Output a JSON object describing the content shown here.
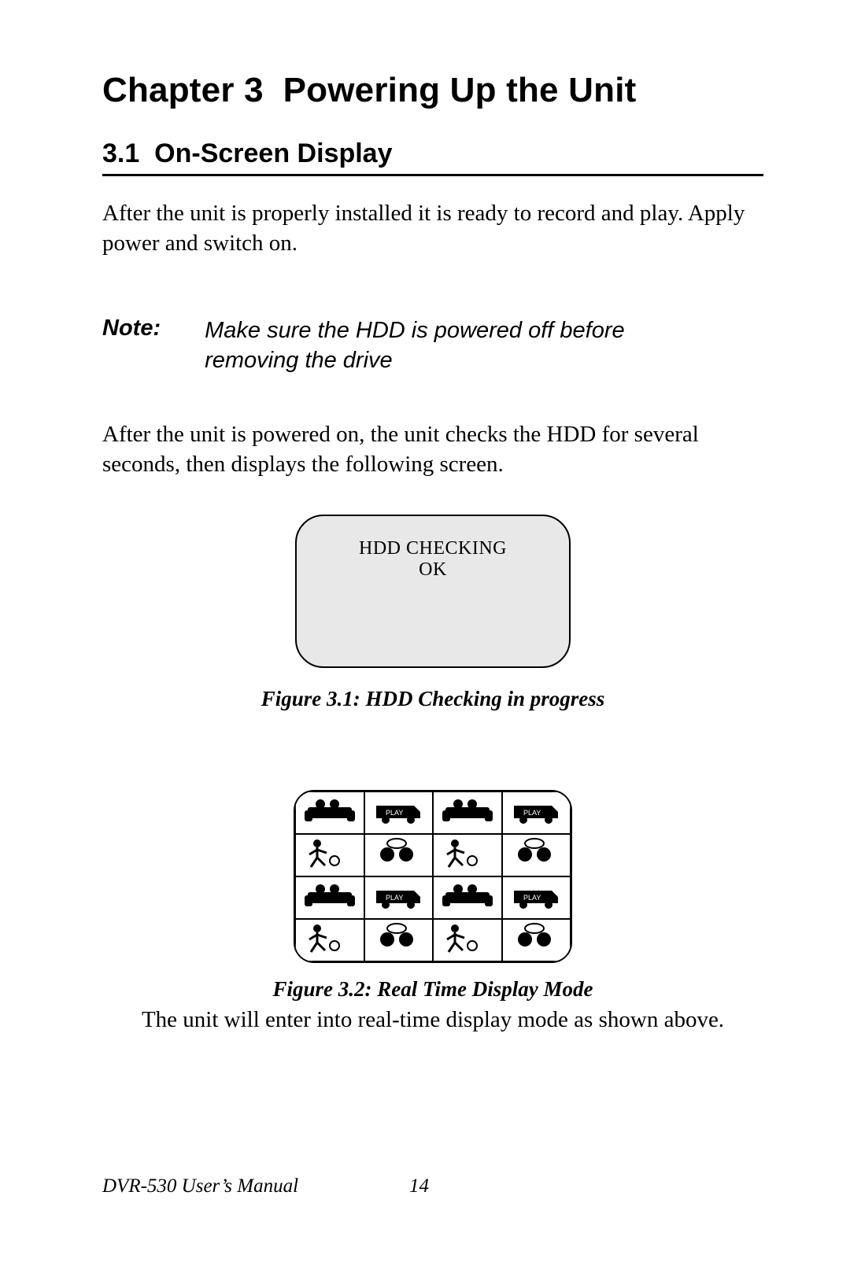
{
  "chapter": {
    "label": "Chapter 3",
    "title": "Powering Up the Unit"
  },
  "section": {
    "number": "3.1",
    "title": "On-Screen Display"
  },
  "paragraphs": {
    "p1": "After the unit is properly installed it is ready to record and play. Apply power and switch on.",
    "p2": "After the unit is powered on, the unit checks the HDD for several seconds, then displays the following screen.",
    "p3": "The unit will enter into real-time display mode as shown above."
  },
  "note": {
    "label": "Note:",
    "text": "Make sure the HDD is powered off before removing the drive"
  },
  "figure1": {
    "line1": "HDD CHECKING",
    "line2": "OK",
    "caption": "Figure 3.1: HDD Checking in progress"
  },
  "figure2": {
    "caption": "Figure 3.2: Real Time Display Mode",
    "grid_icons": [
      "couch",
      "truck",
      "couch",
      "truck",
      "soccer",
      "talk",
      "soccer",
      "talk",
      "couch",
      "truck",
      "couch",
      "truck",
      "soccer",
      "talk",
      "soccer",
      "talk"
    ]
  },
  "footer": {
    "manual": "DVR-530 User’s Manual",
    "page": "14"
  }
}
